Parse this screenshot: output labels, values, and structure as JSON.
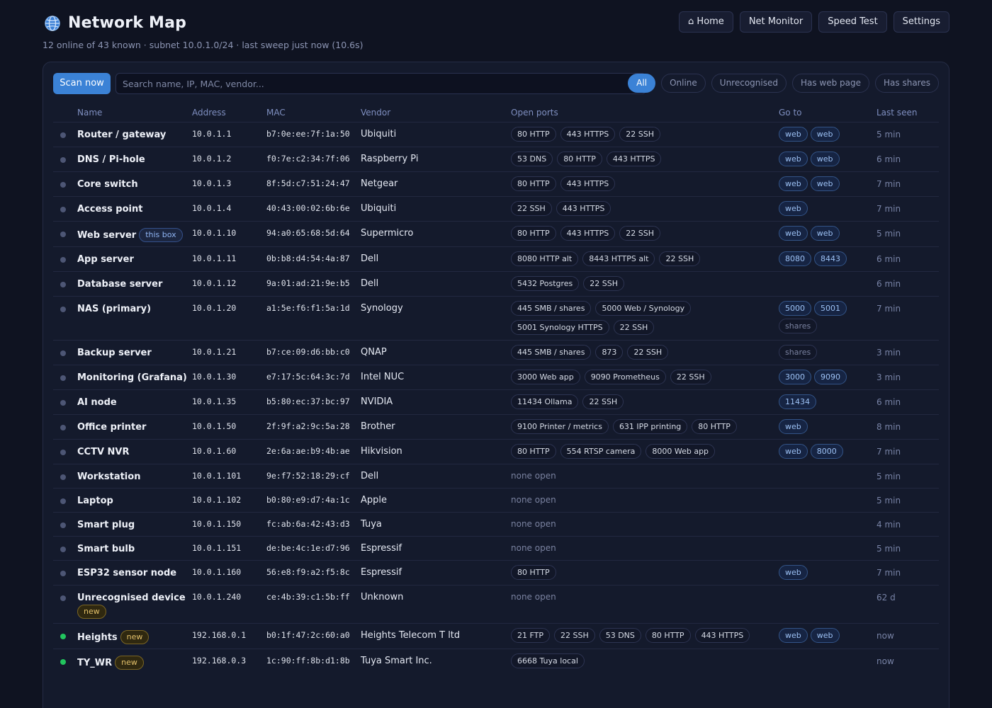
{
  "header": {
    "title": "Network Map",
    "subtitle": "12 online of 43 known · subnet 10.0.1.0/24 · last sweep just now (10.6s)",
    "nav": [
      {
        "label": "⌂ Home"
      },
      {
        "label": "Net Monitor"
      },
      {
        "label": "Speed Test"
      },
      {
        "label": "Settings"
      }
    ]
  },
  "toolbar": {
    "scan_label": "Scan now",
    "search_placeholder": "Search name, IP, MAC, vendor...",
    "filters": [
      {
        "label": "All",
        "active": true
      },
      {
        "label": "Online",
        "active": false
      },
      {
        "label": "Unrecognised",
        "active": false
      },
      {
        "label": "Has web page",
        "active": false
      },
      {
        "label": "Has shares",
        "active": false
      }
    ]
  },
  "table": {
    "columns": [
      "Name",
      "Address",
      "MAC",
      "Vendor",
      "Open ports",
      "Go to",
      "Last seen"
    ],
    "none_open_label": "none open",
    "rows": [
      {
        "name": "Router / gateway",
        "ip": "10.0.1.1",
        "mac": "b7:0e:ee:7f:1a:50",
        "vendor": "Ubiquiti",
        "ports": [
          "80 HTTP",
          "443 HTTPS",
          "22 SSH"
        ],
        "go": [
          "web",
          "web"
        ],
        "seen": "5 min",
        "online": false
      },
      {
        "name": "DNS / Pi-hole",
        "ip": "10.0.1.2",
        "mac": "f0:7e:c2:34:7f:06",
        "vendor": "Raspberry Pi",
        "ports": [
          "53 DNS",
          "80 HTTP",
          "443 HTTPS"
        ],
        "go": [
          "web",
          "web"
        ],
        "seen": "6 min",
        "online": false
      },
      {
        "name": "Core switch",
        "ip": "10.0.1.3",
        "mac": "8f:5d:c7:51:24:47",
        "vendor": "Netgear",
        "ports": [
          "80 HTTP",
          "443 HTTPS"
        ],
        "go": [
          "web",
          "web"
        ],
        "seen": "7 min",
        "online": false
      },
      {
        "name": "Access point",
        "ip": "10.0.1.4",
        "mac": "40:43:00:02:6b:6e",
        "vendor": "Ubiquiti",
        "ports": [
          "22 SSH",
          "443 HTTPS"
        ],
        "go": [
          "web"
        ],
        "seen": "7 min",
        "online": false
      },
      {
        "name": "Web server",
        "tag": "this box",
        "tag_type": "thisbox",
        "ip": "10.0.1.10",
        "mac": "94:a0:65:68:5d:64",
        "vendor": "Supermicro",
        "ports": [
          "80 HTTP",
          "443 HTTPS",
          "22 SSH"
        ],
        "go": [
          "web",
          "web"
        ],
        "seen": "5 min",
        "online": false
      },
      {
        "name": "App server",
        "ip": "10.0.1.11",
        "mac": "0b:b8:d4:54:4a:87",
        "vendor": "Dell",
        "ports": [
          "8080 HTTP alt",
          "8443 HTTPS alt",
          "22 SSH"
        ],
        "go": [
          "8080",
          "8443"
        ],
        "seen": "6 min",
        "online": false
      },
      {
        "name": "Database server",
        "ip": "10.0.1.12",
        "mac": "9a:01:ad:21:9e:b5",
        "vendor": "Dell",
        "ports": [
          "5432 Postgres",
          "22 SSH"
        ],
        "go": [],
        "seen": "6 min",
        "online": false
      },
      {
        "name": "NAS (primary)",
        "ip": "10.0.1.20",
        "mac": "a1:5e:f6:f1:5a:1d",
        "vendor": "Synology",
        "ports": [
          "445 SMB / shares",
          "5000 Web / Synology",
          "5001 Synology HTTPS",
          "22 SSH"
        ],
        "go": [
          "5000",
          "5001",
          "shares"
        ],
        "seen": "7 min",
        "online": false
      },
      {
        "name": "Backup server",
        "ip": "10.0.1.21",
        "mac": "b7:ce:09:d6:bb:c0",
        "vendor": "QNAP",
        "ports": [
          "445 SMB / shares",
          "873",
          "22 SSH"
        ],
        "go": [
          "shares"
        ],
        "seen": "3 min",
        "online": false
      },
      {
        "name": "Monitoring (Grafana)",
        "ip": "10.0.1.30",
        "mac": "e7:17:5c:64:3c:7d",
        "vendor": "Intel NUC",
        "ports": [
          "3000 Web app",
          "9090 Prometheus",
          "22 SSH"
        ],
        "go": [
          "3000",
          "9090"
        ],
        "seen": "3 min",
        "online": false
      },
      {
        "name": "AI node",
        "ip": "10.0.1.35",
        "mac": "b5:80:ec:37:bc:97",
        "vendor": "NVIDIA",
        "ports": [
          "11434 Ollama",
          "22 SSH"
        ],
        "go": [
          "11434"
        ],
        "seen": "6 min",
        "online": false
      },
      {
        "name": "Office printer",
        "ip": "10.0.1.50",
        "mac": "2f:9f:a2:9c:5a:28",
        "vendor": "Brother",
        "ports": [
          "9100 Printer / metrics",
          "631 IPP printing",
          "80 HTTP"
        ],
        "go": [
          "web"
        ],
        "seen": "8 min",
        "online": false
      },
      {
        "name": "CCTV NVR",
        "ip": "10.0.1.60",
        "mac": "2e:6a:ae:b9:4b:ae",
        "vendor": "Hikvision",
        "ports": [
          "80 HTTP",
          "554 RTSP camera",
          "8000 Web app"
        ],
        "go": [
          "web",
          "8000"
        ],
        "seen": "7 min",
        "online": false
      },
      {
        "name": "Workstation",
        "ip": "10.0.1.101",
        "mac": "9e:f7:52:18:29:cf",
        "vendor": "Dell",
        "ports": [],
        "go": [],
        "seen": "5 min",
        "online": false
      },
      {
        "name": "Laptop",
        "ip": "10.0.1.102",
        "mac": "b0:80:e9:d7:4a:1c",
        "vendor": "Apple",
        "ports": [],
        "go": [],
        "seen": "5 min",
        "online": false
      },
      {
        "name": "Smart plug",
        "ip": "10.0.1.150",
        "mac": "fc:ab:6a:42:43:d3",
        "vendor": "Tuya",
        "ports": [],
        "go": [],
        "seen": "4 min",
        "online": false
      },
      {
        "name": "Smart bulb",
        "ip": "10.0.1.151",
        "mac": "de:be:4c:1e:d7:96",
        "vendor": "Espressif",
        "ports": [],
        "go": [],
        "seen": "5 min",
        "online": false
      },
      {
        "name": "ESP32 sensor node",
        "ip": "10.0.1.160",
        "mac": "56:e8:f9:a2:f5:8c",
        "vendor": "Espressif",
        "ports": [
          "80 HTTP"
        ],
        "go": [
          "web"
        ],
        "seen": "7 min",
        "online": false
      },
      {
        "name": "Unrecognised device",
        "tag": "new",
        "tag_type": "new",
        "tag_break": true,
        "ip": "10.0.1.240",
        "mac": "ce:4b:39:c1:5b:ff",
        "vendor": "Unknown",
        "ports": [],
        "go": [],
        "seen": "62 d",
        "online": false
      },
      {
        "name": "Heights",
        "tag": "new",
        "tag_type": "new",
        "ip": "192.168.0.1",
        "mac": "b0:1f:47:2c:60:a0",
        "vendor": "Heights Telecom T ltd",
        "ports": [
          "21 FTP",
          "22 SSH",
          "53 DNS",
          "80 HTTP",
          "443 HTTPS"
        ],
        "go": [
          "web",
          "web"
        ],
        "seen": "now",
        "online": true
      },
      {
        "name": "TY_WR",
        "tag": "new",
        "tag_type": "new",
        "ip": "192.168.0.3",
        "mac": "1c:90:ff:8b:d1:8b",
        "vendor": "Tuya Smart Inc.",
        "ports": [
          "6668 Tuya local"
        ],
        "go": [],
        "seen": "now",
        "online": true
      }
    ]
  }
}
